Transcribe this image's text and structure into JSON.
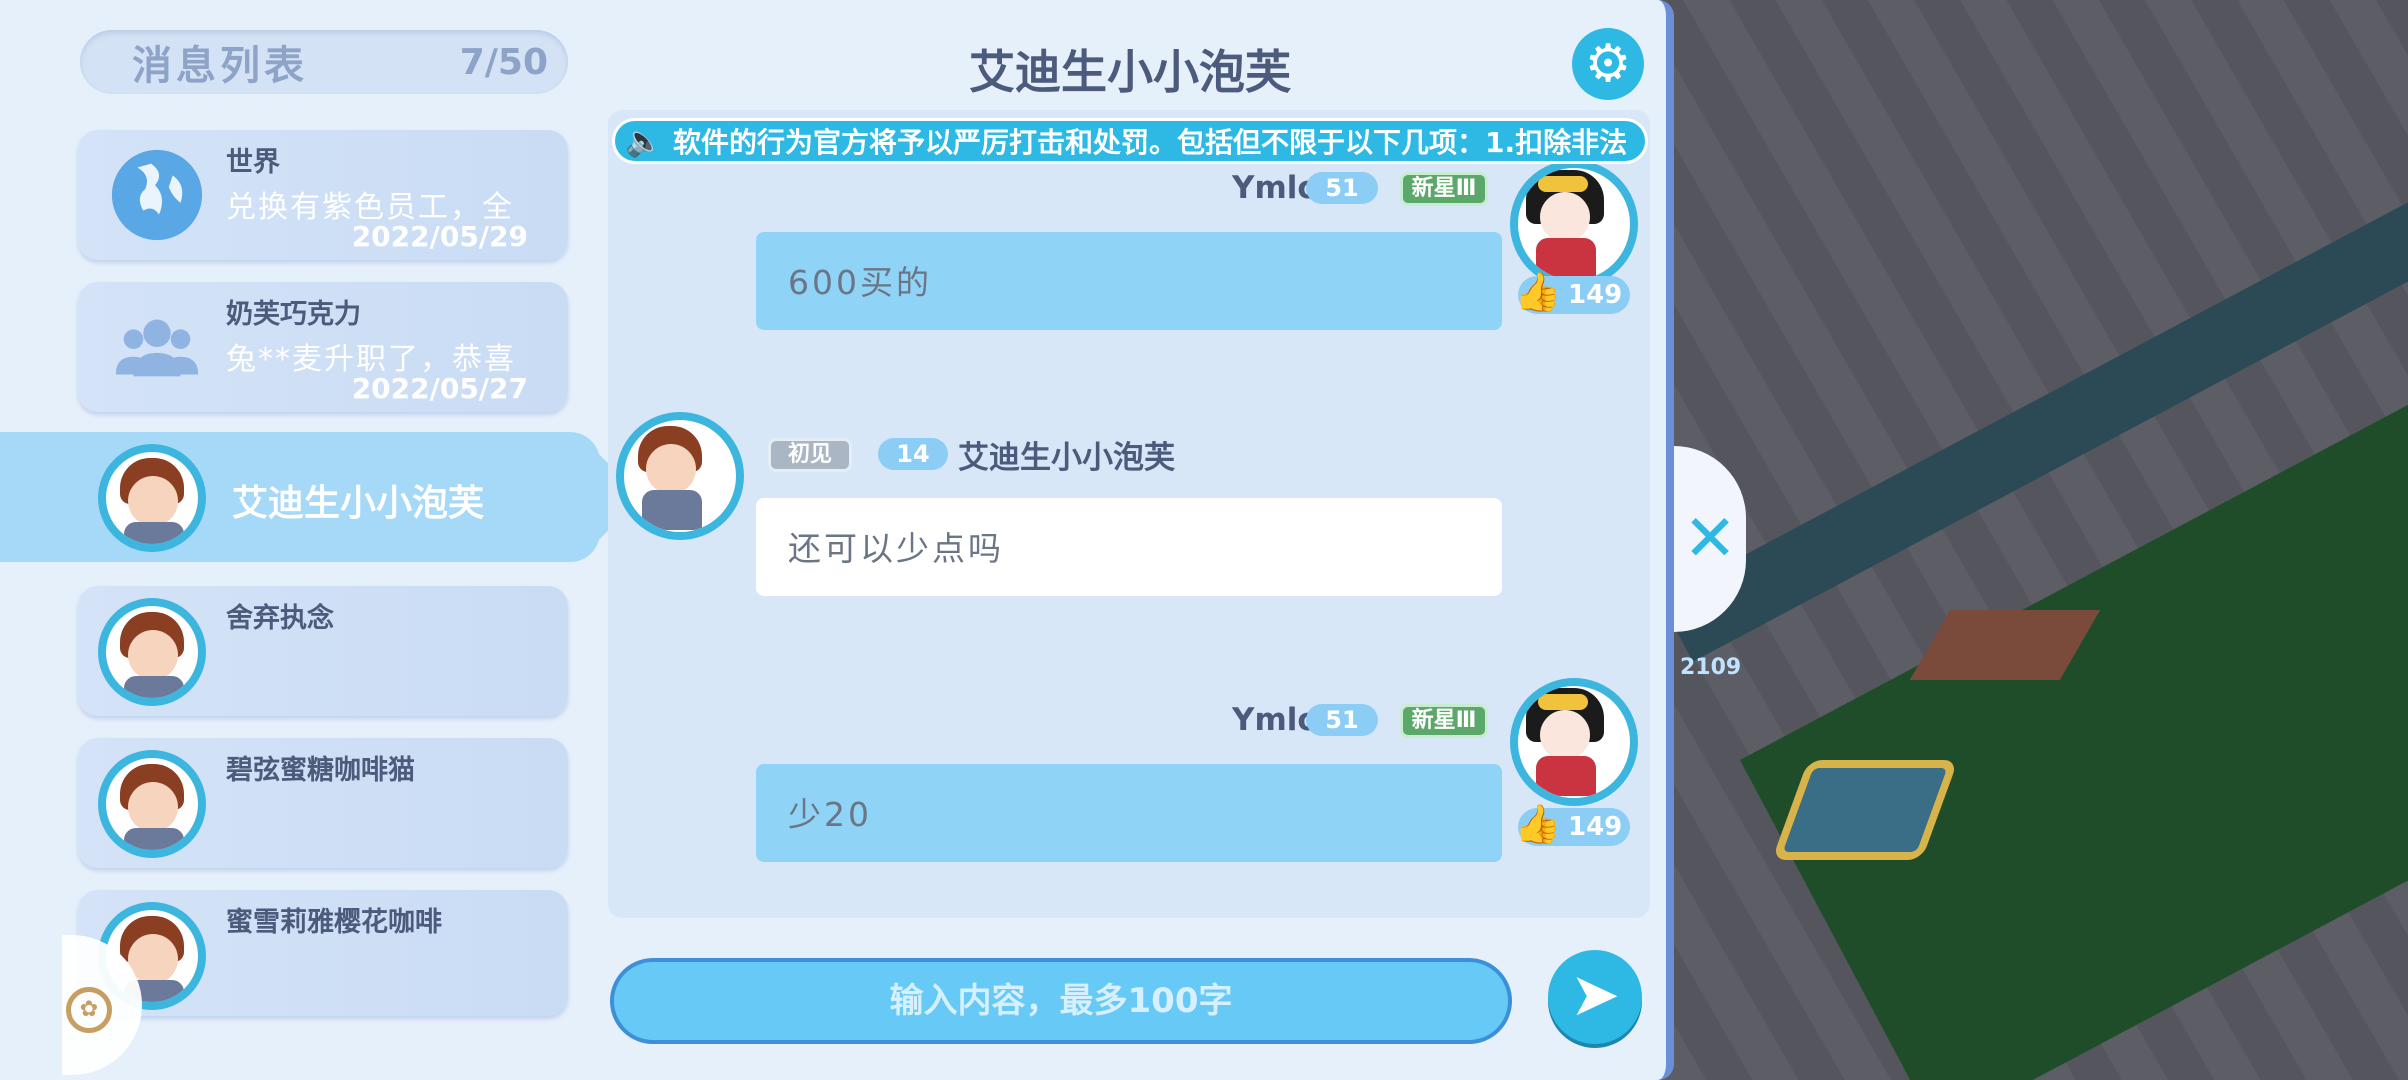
{
  "game": {
    "floating_number": "2109"
  },
  "sidebar": {
    "title": "消息列表",
    "count": "7/50",
    "conversations": [
      {
        "name": "世界",
        "preview": "兑换有紫色员工，全",
        "date": "2022/05/29",
        "icon": "globe-icon"
      },
      {
        "name": "奶芙巧克力",
        "preview": "兔**麦升职了，恭喜",
        "date": "2022/05/27",
        "icon": "group-icon"
      },
      {
        "name": "艾迪生小小泡芙",
        "active": true
      },
      {
        "name": "舍弃执念"
      },
      {
        "name": "碧弦蜜糖咖啡猫"
      },
      {
        "name": "蜜雪莉雅樱花咖啡"
      }
    ]
  },
  "chat": {
    "title": "艾迪生小小泡芙",
    "announcement": "软件的行为官方将予以严厉打击和处罚。包括但不限于以下几项：1.扣除非法",
    "messages": [
      {
        "sender": "Ymlo",
        "level": "51",
        "tag": "新星Ⅲ",
        "text": "600买的",
        "likes": "149",
        "mine": true
      },
      {
        "sender": "艾迪生小小泡芙",
        "level": "14",
        "tag": "初见",
        "text": "还可以少点吗",
        "mine": false
      },
      {
        "sender": "Ymlo",
        "level": "51",
        "tag": "新星Ⅲ",
        "text": "少20",
        "likes": "149",
        "mine": true
      }
    ],
    "input_placeholder": "输入内容，最多100字"
  },
  "colors": {
    "accent": "#2eb9e4",
    "panel_bg": "#e6f0fb",
    "bubble_mine": "#8fd3f7"
  }
}
